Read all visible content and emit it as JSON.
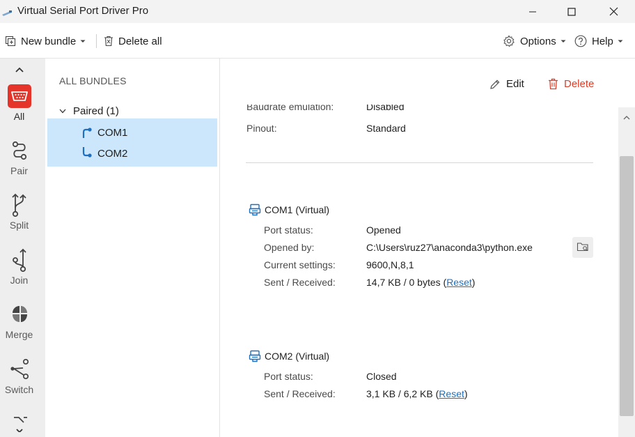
{
  "window": {
    "title": "Virtual Serial Port Driver Pro"
  },
  "toolbar": {
    "new_bundle_label": "New bundle",
    "delete_all_label": "Delete all",
    "options_label": "Options",
    "help_label": "Help"
  },
  "rail": {
    "items": [
      {
        "label": "All",
        "icon": "serial-port-icon"
      },
      {
        "label": "Pair",
        "icon": "pair-icon"
      },
      {
        "label": "Split",
        "icon": "split-icon"
      },
      {
        "label": "Join",
        "icon": "join-icon"
      },
      {
        "label": "Merge",
        "icon": "merge-icon"
      },
      {
        "label": "Switch",
        "icon": "switch-icon"
      }
    ]
  },
  "tree": {
    "header": "ALL BUNDLES",
    "group_label": "Paired (1)",
    "ports": [
      "COM1",
      "COM2"
    ]
  },
  "details": {
    "edit_label": "Edit",
    "delete_label": "Delete",
    "bundle_rows": [
      {
        "label": "Baudrate emulation:",
        "value": "Disabled"
      },
      {
        "label": "Pinout:",
        "value": "Standard"
      }
    ],
    "com1": {
      "title": "COM1 (Virtual)",
      "port_status_label": "Port status:",
      "port_status_value": "Opened",
      "opened_by_label": "Opened by:",
      "opened_by_value": "C:\\Users\\ruz27\\anaconda3\\python.exe",
      "settings_label": "Current settings:",
      "settings_value": "9600,N,8,1",
      "sent_received_label": "Sent / Received:",
      "sent_received_value": "14,7 KB / 0 bytes",
      "reset_label": "Reset"
    },
    "com2": {
      "title": "COM2 (Virtual)",
      "port_status_label": "Port status:",
      "port_status_value": "Closed",
      "sent_received_label": "Sent / Received:",
      "sent_received_value": "3,1 KB / 6,2 KB",
      "reset_label": "Reset"
    }
  },
  "colors": {
    "accent": "#1f6fbf",
    "delete": "#d9412c",
    "selection": "#cce6fb",
    "rail_active": "#e5352b"
  }
}
